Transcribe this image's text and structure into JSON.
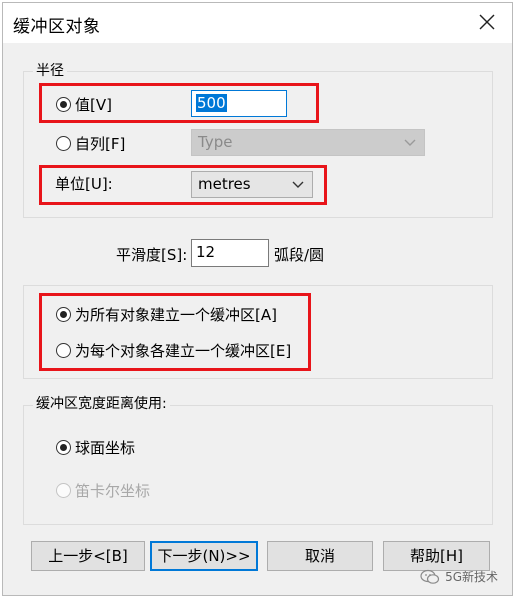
{
  "window": {
    "title": "缓冲区对象",
    "close_glyph": "close-icon"
  },
  "radius_group": {
    "legend": "半径",
    "value_option": {
      "label": "值[V]",
      "selected": true
    },
    "value_input": "500",
    "field_option": {
      "label": "自列[F]",
      "selected": false
    },
    "field_combo": "Type",
    "unit_label": "单位[U]:",
    "unit_combo": "metres"
  },
  "smoothness": {
    "label": "平滑度[S]:",
    "value": "12",
    "unit": "弧段/圆"
  },
  "mode_group": {
    "option_all": {
      "label": "为所有对象建立一个缓冲区[A]",
      "selected": true
    },
    "option_each": {
      "label": "为每个对象各建立一个缓冲区[E]",
      "selected": false
    }
  },
  "distance_group": {
    "legend": "缓冲区宽度距离使用:",
    "spherical": {
      "label": "球面坐标",
      "selected": true
    },
    "cartesian": {
      "label": "笛卡尔坐标",
      "selected": false,
      "disabled": true
    }
  },
  "buttons": {
    "back": "上一步<[B]",
    "next": "下一步(N)>>",
    "cancel": "取消",
    "help": "帮助[H]"
  },
  "watermark": {
    "text": "5G新技术"
  },
  "colors": {
    "highlight_border": "#e8141a",
    "focus_blue": "#0078d7"
  }
}
